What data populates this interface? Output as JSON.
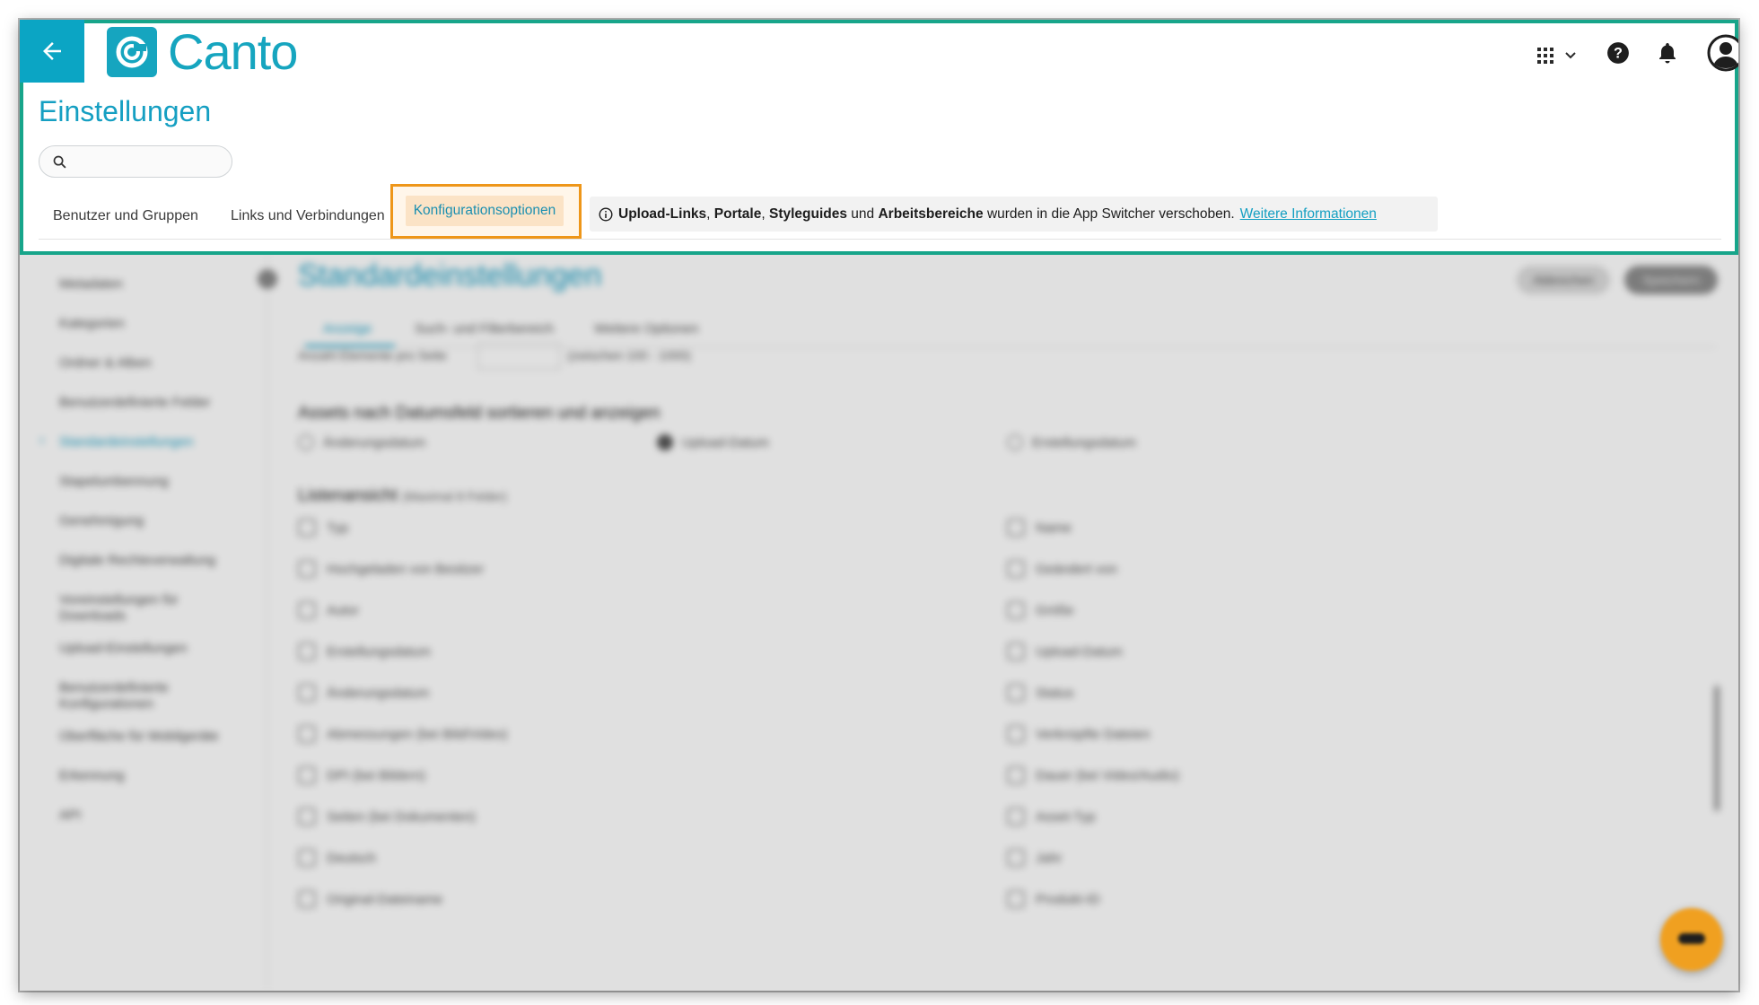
{
  "header": {
    "brand": "Canto",
    "page_title": "Einstellungen",
    "search_placeholder": "",
    "icons": [
      "arrow-left-icon",
      "app-grid-icon",
      "chevron-down-icon",
      "help-icon",
      "bell-icon",
      "user-avatar-icon"
    ]
  },
  "tabs": [
    {
      "label": "Benutzer und Gruppen"
    },
    {
      "label": "Links und Verbindungen"
    },
    {
      "label": "Konfigurationsoptionen",
      "active": true
    }
  ],
  "notice": {
    "part1": "Upload-Links",
    "sep1": ", ",
    "part2": "Portale",
    "sep2": ", ",
    "part3": "Styleguides",
    "sep3": " und ",
    "part4": "Arbeitsbereiche",
    "rest": " wurden in die App Switcher verschoben.",
    "link": "Weitere Informationen"
  },
  "sidebar": {
    "items": [
      "Metadaten",
      "Kategorien",
      "Ordner & Alben",
      "Benutzerdefinierte Felder",
      "Standardeinstellungen",
      "Stapelumbennung",
      "Genehmigung",
      "Digitale Rechteverwaltung",
      "Voreinstellungen für Downloads",
      "Upload-Einstellungen",
      "Benutzerdefinierte Konfigurationen",
      "Oberfläche für Mobilgeräte",
      "Erkennung",
      "API"
    ]
  },
  "main": {
    "title": "Standardeinstellungen",
    "cancel": "Abbrechen",
    "save": "Speichern",
    "subtabs": [
      "Anzeige",
      "Such- und Filterbereich",
      "Weitere Optionen"
    ],
    "count_label": "Anzahl Elemente pro Seite",
    "count_hint": "(zwischen 100 - 1000)",
    "date_section": "Assets nach Datumsfeld sortieren und anzeigen",
    "date_options": [
      "Änderungsdatum",
      "Upload-Datum",
      "Erstellungsdatum"
    ],
    "list_section": "Listenansicht",
    "list_hint": "(Maximal 8 Felder)",
    "left_columns": [
      "Typ",
      "Hochgeladen von Besitzer",
      "Autor",
      "Erstellungsdatum",
      "Änderungsdatum",
      "Abmessungen (bei Bild/Video)",
      "DPI (bei Bildern)",
      "Seiten (bei Dokumenten)",
      "Deutsch",
      "Original-Dateiname"
    ],
    "right_columns": [
      "Name",
      "Geändert von",
      "Größe",
      "Upload-Datum",
      "Status",
      "Verknüpfte Dateien",
      "Dauer (bei Video/Audio)",
      "Asset-Typ",
      "Jahr",
      "Produkt-ID"
    ]
  }
}
